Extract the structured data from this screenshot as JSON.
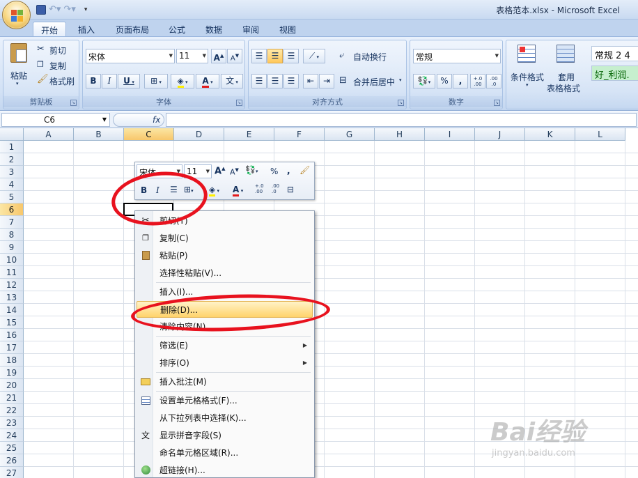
{
  "window": {
    "title": "表格范本.xlsx - Microsoft Excel"
  },
  "tabs": [
    "开始",
    "插入",
    "页面布局",
    "公式",
    "数据",
    "审阅",
    "视图"
  ],
  "ribbon": {
    "clipboard": {
      "label": "剪贴板",
      "paste": "粘贴",
      "cut": "剪切",
      "copy": "复制",
      "format_painter": "格式刷"
    },
    "font": {
      "label": "字体",
      "name": "宋体",
      "size": "11",
      "bold": "B",
      "italic": "I",
      "underline": "U",
      "grow": "A",
      "shrink": "A",
      "font_color": "A",
      "phonetic": "文"
    },
    "alignment": {
      "label": "对齐方式",
      "wrap": "自动换行",
      "merge": "合并后居中"
    },
    "number": {
      "label": "数字",
      "format": "常规",
      "percent": "%",
      "comma": ",",
      "inc_decimal": "+.0\n.00",
      "dec_decimal": ".00\n.0"
    },
    "styles": {
      "conditional": "条件格式",
      "table_format_1": "套用",
      "table_format_2": "表格格式",
      "style_normal": "常规 2 4",
      "style_good": "好_利润."
    }
  },
  "formula_bar": {
    "name_box": "C6",
    "fx": "fx",
    "value": ""
  },
  "columns": [
    "A",
    "B",
    "C",
    "D",
    "E",
    "F",
    "G",
    "H",
    "I",
    "J",
    "K",
    "L"
  ],
  "selected_column": "C",
  "rows": [
    "1",
    "2",
    "3",
    "4",
    "5",
    "6",
    "7",
    "8",
    "9",
    "10",
    "11",
    "12",
    "13",
    "14",
    "15",
    "16",
    "17",
    "18",
    "19",
    "20",
    "21",
    "22",
    "23",
    "24",
    "25",
    "26",
    "27"
  ],
  "selected_row": "6",
  "mini_toolbar": {
    "font": "宋体",
    "size": "11",
    "grow": "A",
    "shrink": "A",
    "percent": "%",
    "comma": ",",
    "bold": "B",
    "italic": "I",
    "font_color": "A",
    "inc_decimal": "+.0\n.00",
    "dec_decimal": ".00\n.0"
  },
  "context_menu": [
    {
      "label": "剪切(T)",
      "icon": "scissors-icon"
    },
    {
      "label": "复制(C)",
      "icon": "copy-icon"
    },
    {
      "label": "粘贴(P)",
      "icon": "paste-icon"
    },
    {
      "label": "选择性粘贴(V)..."
    },
    {
      "label": "插入(I)..."
    },
    {
      "label": "删除(D)...",
      "highlighted": true
    },
    {
      "label": "清除内容(N)"
    },
    {
      "label": "筛选(E)",
      "submenu": true
    },
    {
      "label": "排序(O)",
      "submenu": true
    },
    {
      "label": "插入批注(M)",
      "icon": "comment-icon"
    },
    {
      "label": "设置单元格格式(F)...",
      "icon": "format-cells-icon"
    },
    {
      "label": "从下拉列表中选择(K)..."
    },
    {
      "label": "显示拼音字段(S)",
      "icon": "phonetic-icon"
    },
    {
      "label": "命名单元格区域(R)..."
    },
    {
      "label": "超链接(H)...",
      "icon": "hyperlink-icon"
    }
  ],
  "watermark": {
    "brand": "Bai经验",
    "url": "jingyan.baidu.com"
  },
  "colors": {
    "annotation_ring": "#e8121e",
    "ribbon_bg": "#d2e1f5",
    "highlight": "#ffd36b"
  }
}
